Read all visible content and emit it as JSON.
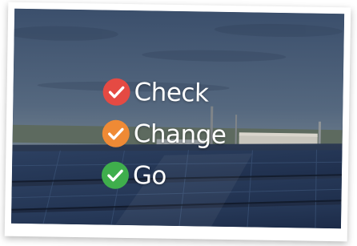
{
  "steps": [
    {
      "label": "Check",
      "badge_color": "#e54a43",
      "icon": "checkmark-icon"
    },
    {
      "label": "Change",
      "badge_color": "#ef8a35",
      "icon": "checkmark-icon"
    },
    {
      "label": "Go",
      "badge_color": "#3fae4c",
      "icon": "checkmark-icon"
    }
  ],
  "colors": {
    "text": "#ffffff",
    "sky_top": "#3f5470",
    "panels": "#24344f",
    "frame": "#ffffff"
  }
}
